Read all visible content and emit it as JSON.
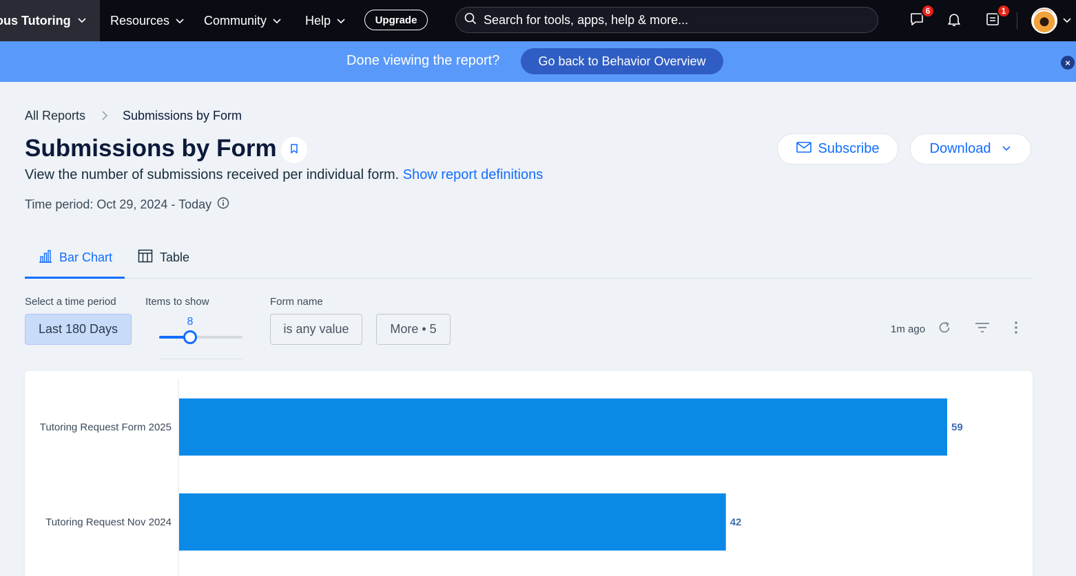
{
  "topbar": {
    "site_name": "ous Tutoring",
    "nav": [
      {
        "label": "Resources"
      },
      {
        "label": "Community"
      },
      {
        "label": "Help"
      }
    ],
    "upgrade_label": "Upgrade",
    "search_placeholder": "Search for tools, apps, help & more...",
    "messages_badge": "6",
    "tasks_badge": "1"
  },
  "banner": {
    "text": "Done viewing the report?",
    "button_label": "Go back to Behavior Overview",
    "close_label": "×"
  },
  "breadcrumb": {
    "root": "All Reports",
    "current": "Submissions by Form"
  },
  "header": {
    "title": "Submissions by Form",
    "description": "View the number of submissions received per individual form.",
    "definitions_link": "Show report definitions",
    "time_period": "Time period: Oct 29, 2024 - Today",
    "subscribe_label": "Subscribe",
    "download_label": "Download"
  },
  "tabs": [
    {
      "label": "Bar Chart",
      "active": true
    },
    {
      "label": "Table",
      "active": false
    }
  ],
  "filters": {
    "time_label": "Select a time period",
    "time_value": "Last 180 Days",
    "items_label": "Items to show",
    "items_value": "8",
    "items_fraction": 0.37,
    "form_label": "Form name",
    "form_value": "is any value",
    "more_label": "More • 5",
    "updated": "1m ago"
  },
  "colors": {
    "accent": "#116dff",
    "bar": "#0a8ae6",
    "banner": "#5999fa"
  },
  "chart_data": {
    "type": "bar",
    "orientation": "horizontal",
    "categories": [
      "Tutoring Request Form 2025",
      "Tutoring Request Nov 2024"
    ],
    "values": [
      59,
      42
    ],
    "data_labels": [
      "59",
      "42"
    ],
    "xlim": [
      0,
      59
    ],
    "grid": false,
    "legend": "none"
  }
}
